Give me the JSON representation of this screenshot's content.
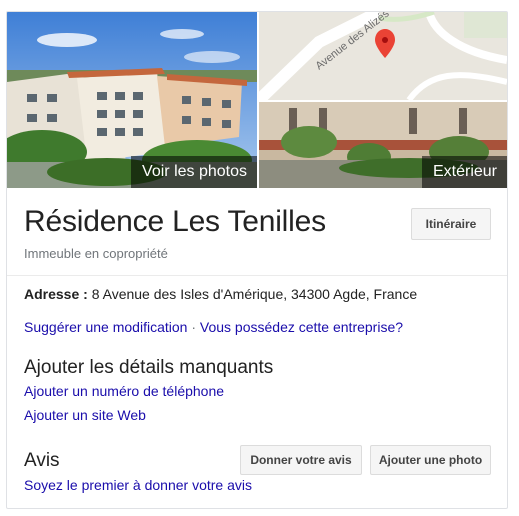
{
  "photos": {
    "main_label": "Voir les photos",
    "exterior_label": "Extérieur",
    "map_street": "Avenue des Alizés"
  },
  "place": {
    "name": "Résidence Les Tenilles",
    "category": "Immeuble en copropriété",
    "route_label": "Itinéraire"
  },
  "address": {
    "label": "Adresse :",
    "value": "8 Avenue des Isles d'Amérique, 34300 Agde, France"
  },
  "edit_links": {
    "suggest": "Suggérer une modification",
    "separator": "·",
    "own": "Vous possédez cette entreprise?"
  },
  "missing": {
    "title": "Ajouter les détails manquants",
    "phone": "Ajouter un numéro de téléphone",
    "website": "Ajouter un site Web"
  },
  "reviews": {
    "title": "Avis",
    "give_review": "Donner votre avis",
    "add_photo": "Ajouter une photo",
    "first_review": "Soyez le premier à donner votre avis"
  },
  "colors": {
    "link": "#1a0dab",
    "pin": "#ea4335",
    "title": "#222222",
    "muted": "#70757a"
  }
}
